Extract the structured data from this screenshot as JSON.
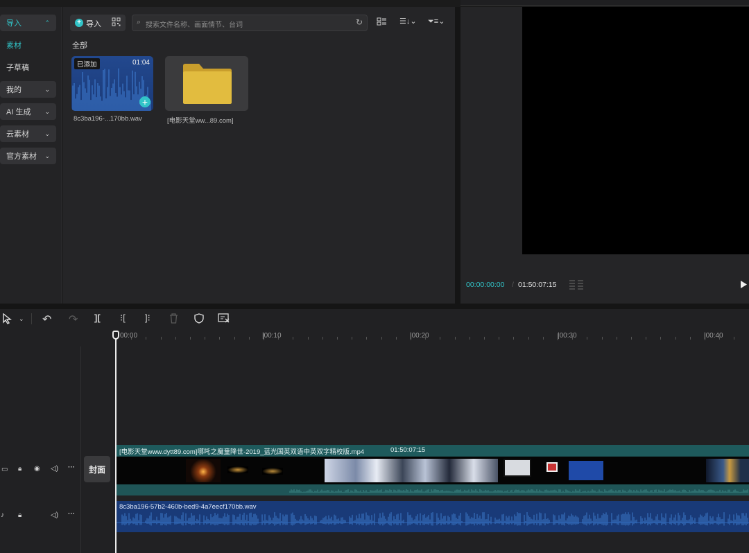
{
  "nav": {
    "items": [
      {
        "label": "导入",
        "chevron": "⌃",
        "active": true
      },
      {
        "label": "素材",
        "chevron": "",
        "active": true
      },
      {
        "label": "子草稿",
        "chevron": ""
      },
      {
        "label": "我的",
        "chevron": "⌄"
      },
      {
        "label": "AI 生成",
        "chevron": "⌄"
      },
      {
        "label": "云素材",
        "chevron": "⌄"
      },
      {
        "label": "官方素材",
        "chevron": "⌄"
      }
    ]
  },
  "media": {
    "import_label": "导入",
    "search_placeholder": "搜索文件名称、画面情节、台词",
    "section_title": "全部",
    "audio_item": {
      "badge": "已添加",
      "duration": "01:04",
      "name": "8c3ba196-...170bb.wav"
    },
    "folder_item": {
      "name": "[电影天堂ww...89.com]"
    }
  },
  "preview": {
    "current_time": "00:00:00:00",
    "total_time": "01:50:07:15"
  },
  "timeline": {
    "ruler_labels": [
      "00:00",
      "|00:10",
      "|00:20",
      "|00:30",
      "|00:40"
    ],
    "cover_label": "封面",
    "video_clip": {
      "title": "[电影天堂www.dytt89.com]哪吒之魔童降世-2019_蓝光国英双语中英双字精校版.mp4",
      "duration": "01:50:07:15"
    },
    "audio_clip": {
      "title": "8c3ba196-57b2-460b-bed9-4a7eecf170bb.wav"
    }
  },
  "colors": {
    "accent": "#32c4c8",
    "audio_clip": "#193a78",
    "video_clip": "#1a4a4c",
    "folder": "#e2bc3f"
  }
}
